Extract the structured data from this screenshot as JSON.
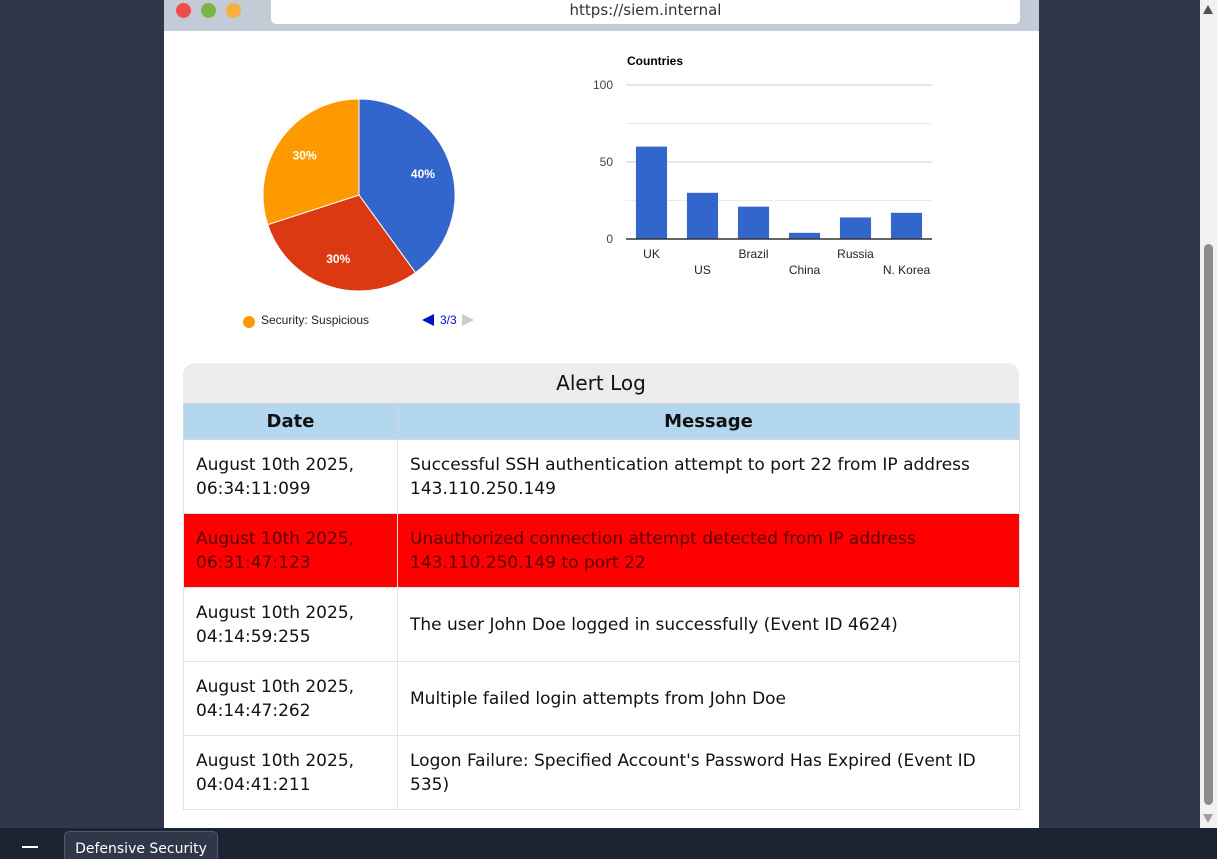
{
  "browser": {
    "url": "https://siem.internal"
  },
  "pie": {
    "legend_label": "Security: Suspicious",
    "legend_color": "#ff9900",
    "pager": "3/3"
  },
  "chart_data": [
    {
      "type": "pie",
      "slices": [
        {
          "value": 40,
          "label": "40%",
          "color": "#3366cc"
        },
        {
          "value": 30,
          "label": "30%",
          "color": "#dc3912"
        },
        {
          "value": 30,
          "label": "30%",
          "color": "#ff9900"
        }
      ],
      "legend": [
        "Security: Suspicious"
      ]
    },
    {
      "type": "bar",
      "title": "Countries",
      "categories": [
        "UK",
        "US",
        "Brazil",
        "China",
        "Russia",
        "N. Korea"
      ],
      "values": [
        60,
        30,
        21,
        4,
        14,
        17
      ],
      "ylim": [
        0,
        100
      ],
      "yticks": [
        0,
        50,
        100
      ],
      "color": "#3366cc",
      "grid": true
    }
  ],
  "alert_log": {
    "title": "Alert Log",
    "columns": [
      "Date",
      "Message"
    ],
    "rows": [
      {
        "date": "August 10th 2025, 06:34:11:099",
        "message": "Successful SSH authentication attempt to port 22 from IP address 143.110.250.149",
        "highlight": false
      },
      {
        "date": "August 10th 2025, 06:31:47:123",
        "message": "Unauthorized connection attempt detected from IP address 143.110.250.149 to port 22",
        "highlight": true
      },
      {
        "date": "August 10th 2025, 04:14:59:255",
        "message": "The user John Doe logged in successfully (Event ID 4624)",
        "highlight": false
      },
      {
        "date": "August 10th 2025, 04:14:47:262",
        "message": "Multiple failed login attempts from John Doe",
        "highlight": false
      },
      {
        "date": "August 10th 2025, 04:04:41:211",
        "message": "Logon Failure: Specified Account's Password Has Expired (Event ID 535)",
        "highlight": false
      }
    ],
    "highlight_color": "#ff0000",
    "header_color": "#b3d7ee"
  },
  "taskbar": {
    "tab_label": "Defensive Security"
  }
}
